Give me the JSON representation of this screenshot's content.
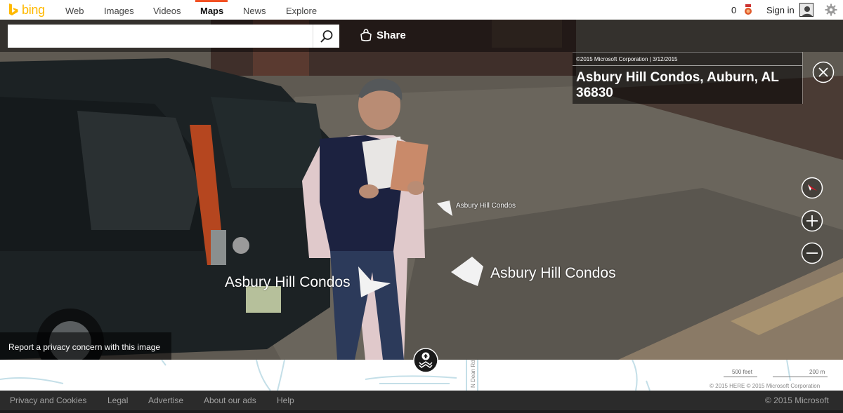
{
  "brand": {
    "name": "bing",
    "accent": "#ffb900"
  },
  "nav": {
    "links": [
      "Web",
      "Images",
      "Videos",
      "Maps",
      "News",
      "Explore"
    ],
    "active": "Maps",
    "active_color": "#f25022"
  },
  "account": {
    "rewards_count": "0",
    "signin_label": "Sign in"
  },
  "search": {
    "value": "",
    "placeholder": "",
    "icon": "search-icon"
  },
  "share": {
    "label": "Share",
    "icon": "share-bag-icon"
  },
  "streetside": {
    "image_copyright": "©2015 Microsoft Corporation | 3/12/2015",
    "address": "Asbury Hill Condos, Auburn, AL 36830",
    "labels": [
      "Asbury Hill Condos",
      "Asbury Hill Condos",
      "Asbury Hill Condos"
    ],
    "privacy_link": "Report a privacy concern with this image",
    "controls": [
      "close-icon",
      "compass-icon",
      "zoom-in-icon",
      "zoom-out-icon",
      "home-navigation-icon"
    ]
  },
  "minimap": {
    "street_label": "N Dean Rd",
    "scale_feet": "500 feet",
    "scale_meters": "200 m",
    "copyright": "© 2015 HERE © 2015 Microsoft Corporation"
  },
  "footer": {
    "links": [
      "Privacy and Cookies",
      "Legal",
      "Advertise",
      "About our ads",
      "Help"
    ],
    "copyright": "© 2015 Microsoft"
  }
}
